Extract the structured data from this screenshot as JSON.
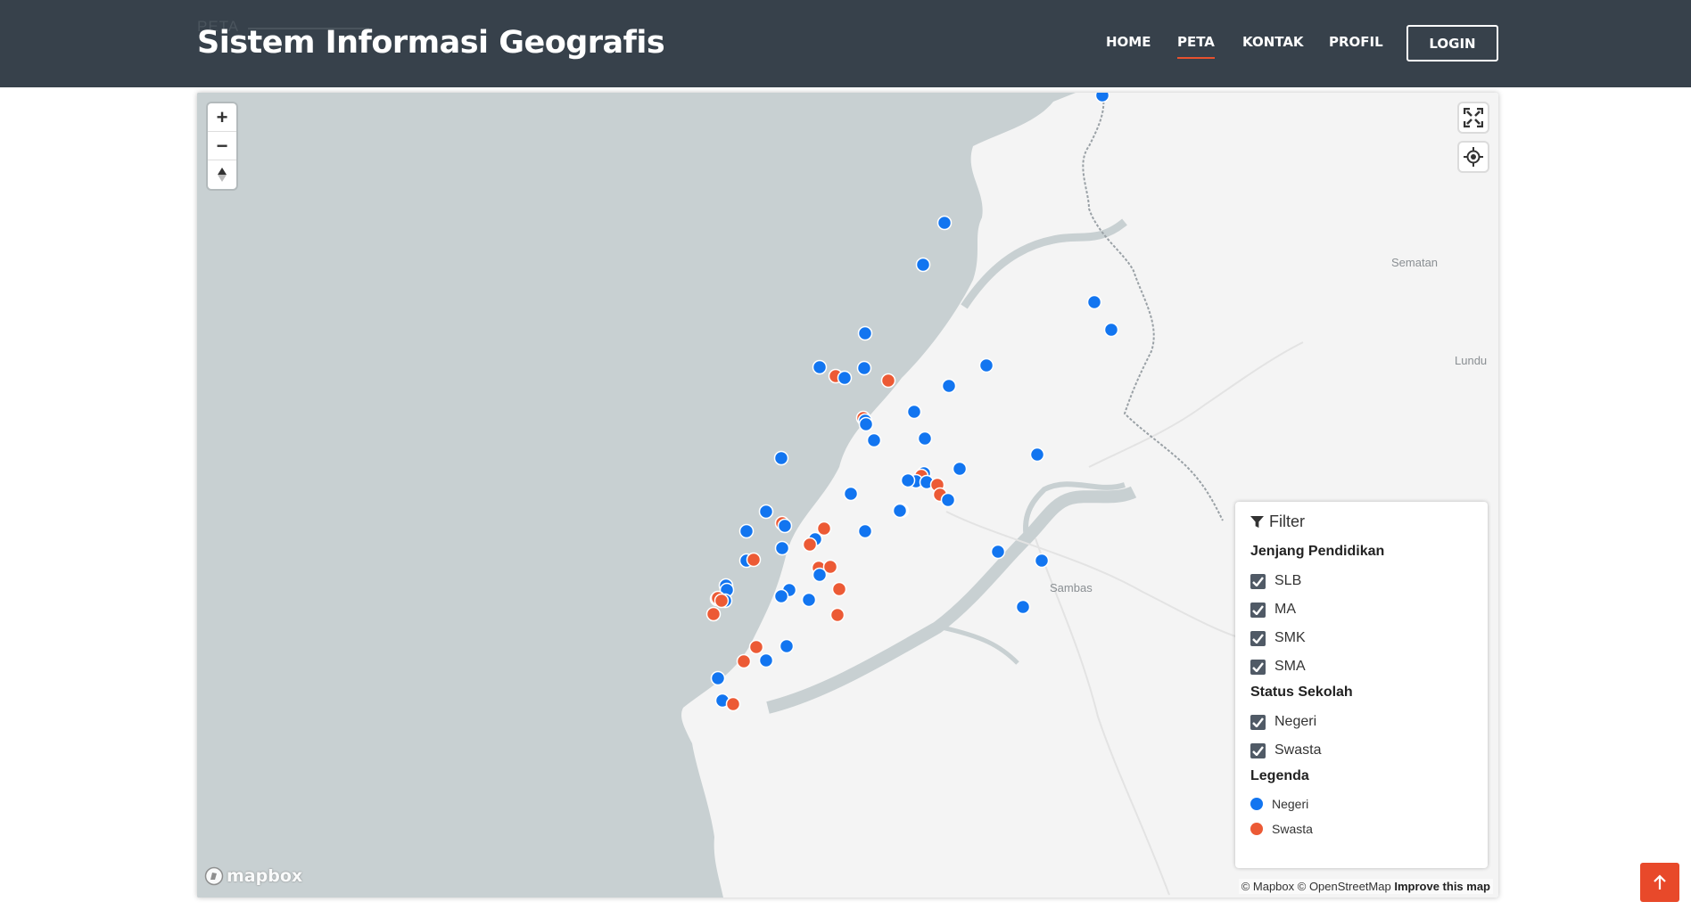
{
  "header": {
    "ghost_text": "PETA",
    "brand": "Sistem Informasi Geografis",
    "nav": [
      {
        "label": "HOME"
      },
      {
        "label": "PETA"
      },
      {
        "label": "KONTAK"
      },
      {
        "label": "PROFIL"
      }
    ],
    "login": "LOGIN"
  },
  "map": {
    "place_labels": [
      "Sematan",
      "Lundu",
      "Sambas"
    ],
    "logo": "mapbox",
    "attribution": "© Mapbox © OpenStreetMap",
    "improve": "Improve this map",
    "colors": {
      "negeri": "#1275f0",
      "swasta": "#ec5a35",
      "water": "#c8d0d2",
      "land": "#f4f4f4"
    }
  },
  "filter": {
    "title": "Filter",
    "jenjang_title": "Jenjang Pendidikan",
    "jenjang": [
      {
        "label": "SLB",
        "checked": true
      },
      {
        "label": "MA",
        "checked": true
      },
      {
        "label": "SMK",
        "checked": true
      },
      {
        "label": "SMA",
        "checked": true
      }
    ],
    "status_title": "Status Sekolah",
    "status": [
      {
        "label": "Negeri",
        "checked": true
      },
      {
        "label": "Swasta",
        "checked": true
      }
    ],
    "legend_title": "Legenda",
    "legend": [
      {
        "label": "Negeri",
        "color": "#1275f0"
      },
      {
        "label": "Swasta",
        "color": "#ec5a35"
      }
    ]
  }
}
